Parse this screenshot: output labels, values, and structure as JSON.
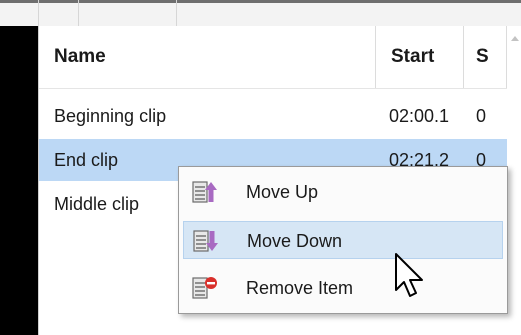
{
  "table": {
    "columns": [
      "Name",
      "Start",
      "S"
    ],
    "rows": [
      {
        "name": "Beginning clip",
        "start": "02:00.1",
        "extra": "0",
        "selected": false
      },
      {
        "name": "End clip",
        "start": "02:21.2",
        "extra": "0",
        "selected": true
      },
      {
        "name": "Middle clip",
        "start": "",
        "extra": "",
        "selected": false
      }
    ]
  },
  "context_menu": {
    "items": [
      {
        "label": "Move Up",
        "icon": "move-up-icon"
      },
      {
        "label": "Move Down",
        "icon": "move-down-icon",
        "hovered": true
      },
      {
        "label": "Remove Item",
        "icon": "remove-item-icon"
      }
    ]
  },
  "colors": {
    "selection": "#bcd8f5",
    "hover": "#d6e6f5",
    "arrow_purple": "#a86ac2",
    "remove_red": "#d9302b"
  }
}
